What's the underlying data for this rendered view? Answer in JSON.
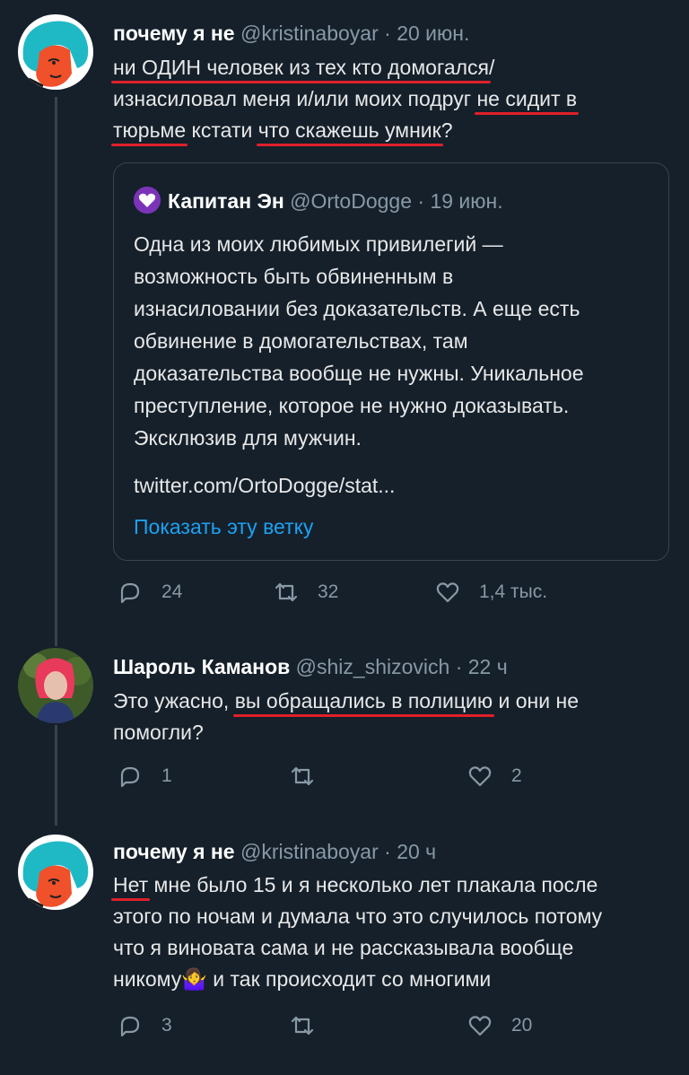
{
  "tweets": [
    {
      "name": "почему я не",
      "handle": "@kristinaboyar",
      "dot": "·",
      "time": "20 июн.",
      "lines": [
        {
          "parts": [
            {
              "t": "ни ОДИН человек из тех кто домогался",
              "u": true
            },
            {
              "t": "/",
              "u": false
            }
          ]
        },
        {
          "parts": [
            {
              "t": "изнасиловал меня и/или моих подруг ",
              "u": false
            },
            {
              "t": "не сидит в",
              "u": true
            }
          ]
        },
        {
          "parts": [
            {
              "t": "тюрьме",
              "u": true
            },
            {
              "t": " кстати ",
              "u": false
            },
            {
              "t": "что скажешь умник",
              "u": true
            },
            {
              "t": "?",
              "u": false
            }
          ]
        }
      ],
      "quote": {
        "name": "Капитан Эн",
        "handle": "@OrtoDogge",
        "dot": "·",
        "time": "19 июн.",
        "lines": [
          "Одна из моих любимых привилегий —",
          "возможность быть обвиненным в",
          "изнасиловании без доказательств. А еще есть",
          "обвинение в домогательствах, там",
          "доказательства вообще не нужны. Уникальное",
          "преступление, которое не нужно доказывать.",
          "Эксклюзив для мужчин."
        ],
        "link": "twitter.com/OrtoDogge/stat...",
        "show_thread": "Показать эту ветку"
      },
      "replies": "24",
      "retweets": "32",
      "likes": "1,4 тыс."
    },
    {
      "name": "Шароль Каманов",
      "handle": "@shiz_shizovich",
      "dot": "·",
      "time": "22 ч",
      "lines": [
        {
          "parts": [
            {
              "t": "Это ужасно, ",
              "u": false
            },
            {
              "t": "вы обращались в полицию",
              "u": true
            },
            {
              "t": " и они не",
              "u": false
            }
          ]
        },
        {
          "parts": [
            {
              "t": "помогли?",
              "u": false
            }
          ]
        }
      ],
      "replies": "1",
      "retweets": "",
      "likes": "2"
    },
    {
      "name": "почему я не",
      "handle": "@kristinaboyar",
      "dot": "·",
      "time": "20 ч",
      "lines": [
        {
          "parts": [
            {
              "t": "Нет",
              "u": true
            },
            {
              "t": " мне было 15 и я несколько лет плакала после",
              "u": false
            }
          ]
        },
        {
          "parts": [
            {
              "t": "этого по ночам и думала что это случилось потому",
              "u": false
            }
          ]
        },
        {
          "parts": [
            {
              "t": "что я виновата сама и не рассказывала вообще",
              "u": false
            }
          ]
        },
        {
          "parts": [
            {
              "t": "никому🤷‍♀️ и так происходит со многими",
              "u": false
            }
          ]
        }
      ],
      "replies": "3",
      "retweets": "",
      "likes": "20"
    }
  ],
  "colors": {
    "background": "#15202b",
    "underline": "#e0202b",
    "link": "#1da1f2",
    "muted": "#8899a6"
  }
}
